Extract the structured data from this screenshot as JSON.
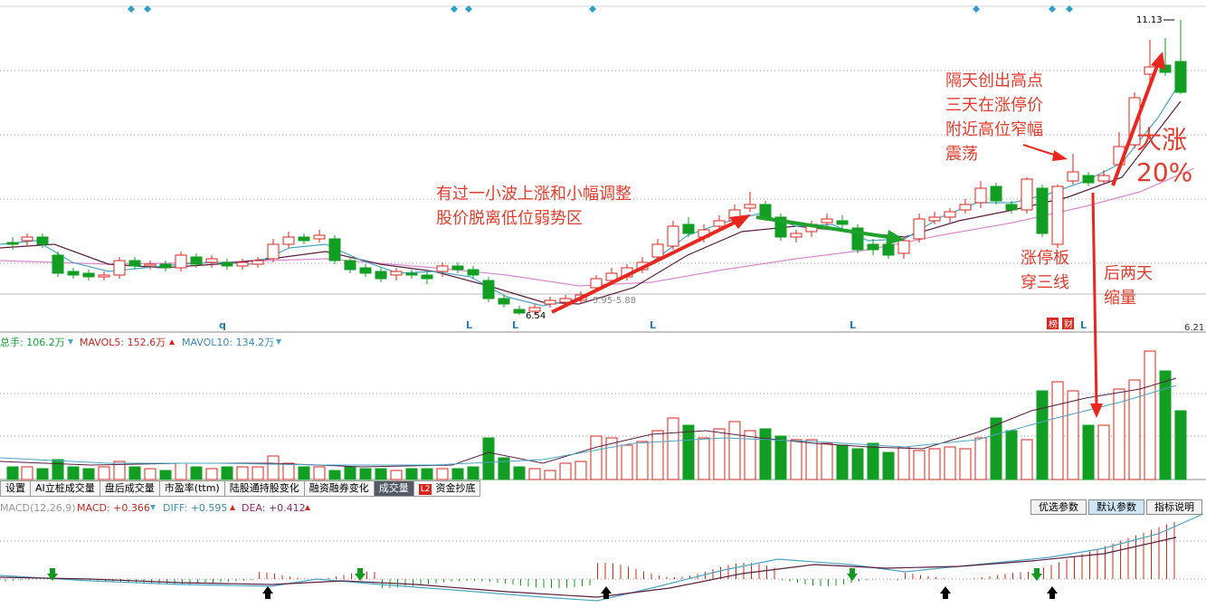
{
  "price": {
    "high_label": "11.13",
    "low_label": "6.54",
    "cost_label": "5.95-5.88",
    "right_value": "6.21",
    "markers": [
      "q",
      "L",
      "L",
      "L",
      "L",
      "L"
    ],
    "flag_labels": [
      "榜",
      "财"
    ]
  },
  "annotations": {
    "a1": [
      "有过一小波上涨和小幅调整",
      "股价脱离低位弱势区"
    ],
    "a2": [
      "隔天创出高点",
      "三天在涨停价",
      "附近高位窄幅",
      "震荡"
    ],
    "a3": [
      "大涨",
      "20%"
    ],
    "a4": [
      "涨停板",
      "穿三线"
    ],
    "a5": [
      "后两天",
      "缩量"
    ]
  },
  "volume": {
    "total_label": "总手: 106.2万",
    "mavol5_label": "MAVOL5: 152.6万",
    "mavol10_label": "MAVOL10: 134.2万"
  },
  "tabs": [
    {
      "label": "设置"
    },
    {
      "label": "AI立桩成交量"
    },
    {
      "label": "盘后成交量"
    },
    {
      "label": "市盈率(ttm)"
    },
    {
      "label": "陆股通持股变化"
    },
    {
      "label": "融资融券变化"
    },
    {
      "label": "成交量"
    },
    {
      "label": "资金抄底",
      "badge": "L2"
    }
  ],
  "active_tab": "成交量",
  "macd": {
    "name_label": "MACD(12,26,9)",
    "macd_label": "MACD: +0.366",
    "diff_label": "DIFF: +0.595",
    "dea_label": "DEA: +0.412"
  },
  "param_buttons": [
    "优选参数",
    "默认参数",
    "指标说明"
  ],
  "colors": {
    "up": "#d9241b",
    "down": "#129e22",
    "ma_light": "#4aa6c4",
    "ma_dark": "#5b1e3f",
    "ma_pink": "#d98ad1",
    "grid": "#9a9a9a",
    "diamond": "#2d9fc9",
    "annotation": "#e23d2c"
  }
}
